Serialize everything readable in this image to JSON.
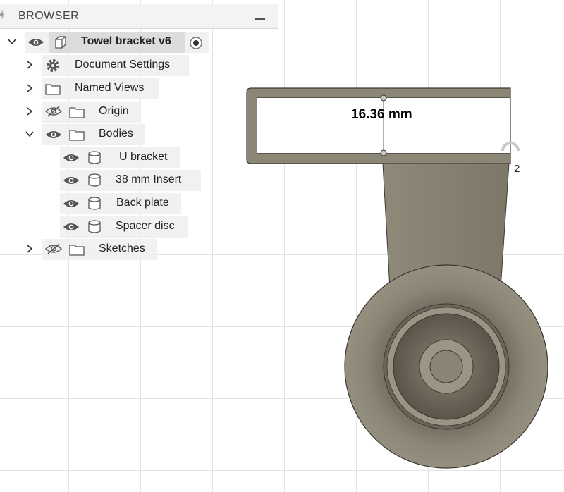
{
  "browser": {
    "title": "BROWSER",
    "root": {
      "label": "Towel bracket v6"
    },
    "items": [
      {
        "label": "Document Settings",
        "icon": "gear-icon",
        "expanded": false
      },
      {
        "label": "Named Views",
        "icon": "folder-icon",
        "expanded": false
      },
      {
        "label": "Origin",
        "icon": "folder-icon",
        "visibility": "hidden",
        "expanded": false
      },
      {
        "label": "Bodies",
        "icon": "folder-icon",
        "visibility": "visible",
        "expanded": true
      },
      {
        "label": "Sketches",
        "icon": "folder-icon",
        "visibility": "hidden",
        "expanded": false
      }
    ],
    "bodies": [
      {
        "label": "U bracket",
        "icon": "body-icon"
      },
      {
        "label": "38 mm Insert",
        "icon": "body-icon"
      },
      {
        "label": "Back plate",
        "icon": "body-icon"
      },
      {
        "label": "Spacer disc",
        "icon": "body-icon"
      }
    ]
  },
  "viewport": {
    "dimension": "16.36 mm",
    "axis_label": "2",
    "colors": {
      "body": "#8c8676",
      "axis_red": "#e8a3a3",
      "axis_blue": "#a9c0e6",
      "grid": "#e4e4e4"
    }
  }
}
